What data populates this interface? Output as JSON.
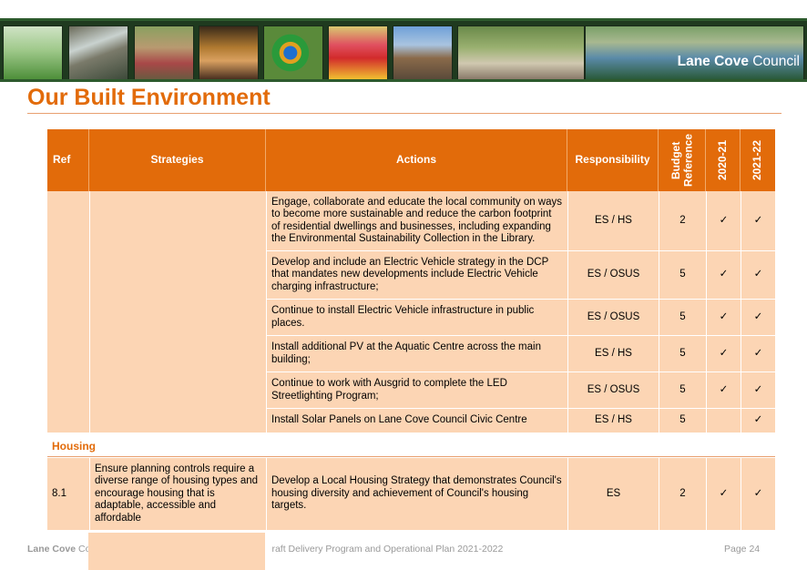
{
  "banner": {
    "brand_bold": "Lane Cove",
    "brand_rest": " Council"
  },
  "page": {
    "title": "Our Built Environment"
  },
  "table": {
    "headers": {
      "ref": "Ref",
      "strategies": "Strategies",
      "actions": "Actions",
      "responsibility": "Responsibility",
      "budget": "Budget Reference",
      "year1": "2020-21",
      "year2": "2021-22"
    },
    "rows": [
      {
        "action": "Engage, collaborate and educate the local community on ways to become more sustainable and reduce the carbon footprint of residential dwellings and businesses, including expanding the Environmental Sustainability Collection in the Library.",
        "responsibility": "ES / HS",
        "budget": "2",
        "y1": "✓",
        "y2": "✓"
      },
      {
        "action": "Develop and include an Electric Vehicle strategy in the DCP that mandates new developments include Electric Vehicle charging infrastructure;",
        "responsibility": "ES / OSUS",
        "budget": "5",
        "y1": "✓",
        "y2": "✓"
      },
      {
        "action": "Continue to install Electric Vehicle infrastructure in public places.",
        "responsibility": "ES / OSUS",
        "budget": "5",
        "y1": "✓",
        "y2": "✓"
      },
      {
        "action": "Install additional PV at the Aquatic Centre across the main building;",
        "responsibility": "ES / HS",
        "budget": "5",
        "y1": "✓",
        "y2": "✓"
      },
      {
        "action": "Continue to work with Ausgrid to complete the LED Streetlighting Program;",
        "responsibility": "ES / OSUS",
        "budget": "5",
        "y1": "✓",
        "y2": "✓"
      },
      {
        "action": "Install Solar Panels on Lane Cove Council Civic Centre",
        "responsibility": "ES / HS",
        "budget": "5",
        "y1": "",
        "y2": "✓"
      }
    ],
    "section": "Housing",
    "housing_row": {
      "ref": "8.1",
      "strategy": "Ensure planning controls require a diverse range of housing types and encourage housing that is adaptable, accessible and affordable",
      "action": "Develop a Local Housing Strategy that demonstrates Council's housing diversity and achievement of Council's housing targets.",
      "responsibility": "ES",
      "budget": "2",
      "y1": "✓",
      "y2": "✓"
    }
  },
  "footer": {
    "org_bold": "Lane Cove",
    "org_rest": " Co",
    "doc": "raft Delivery Program and Operational Plan  2021-2022",
    "page": "Page 24"
  }
}
